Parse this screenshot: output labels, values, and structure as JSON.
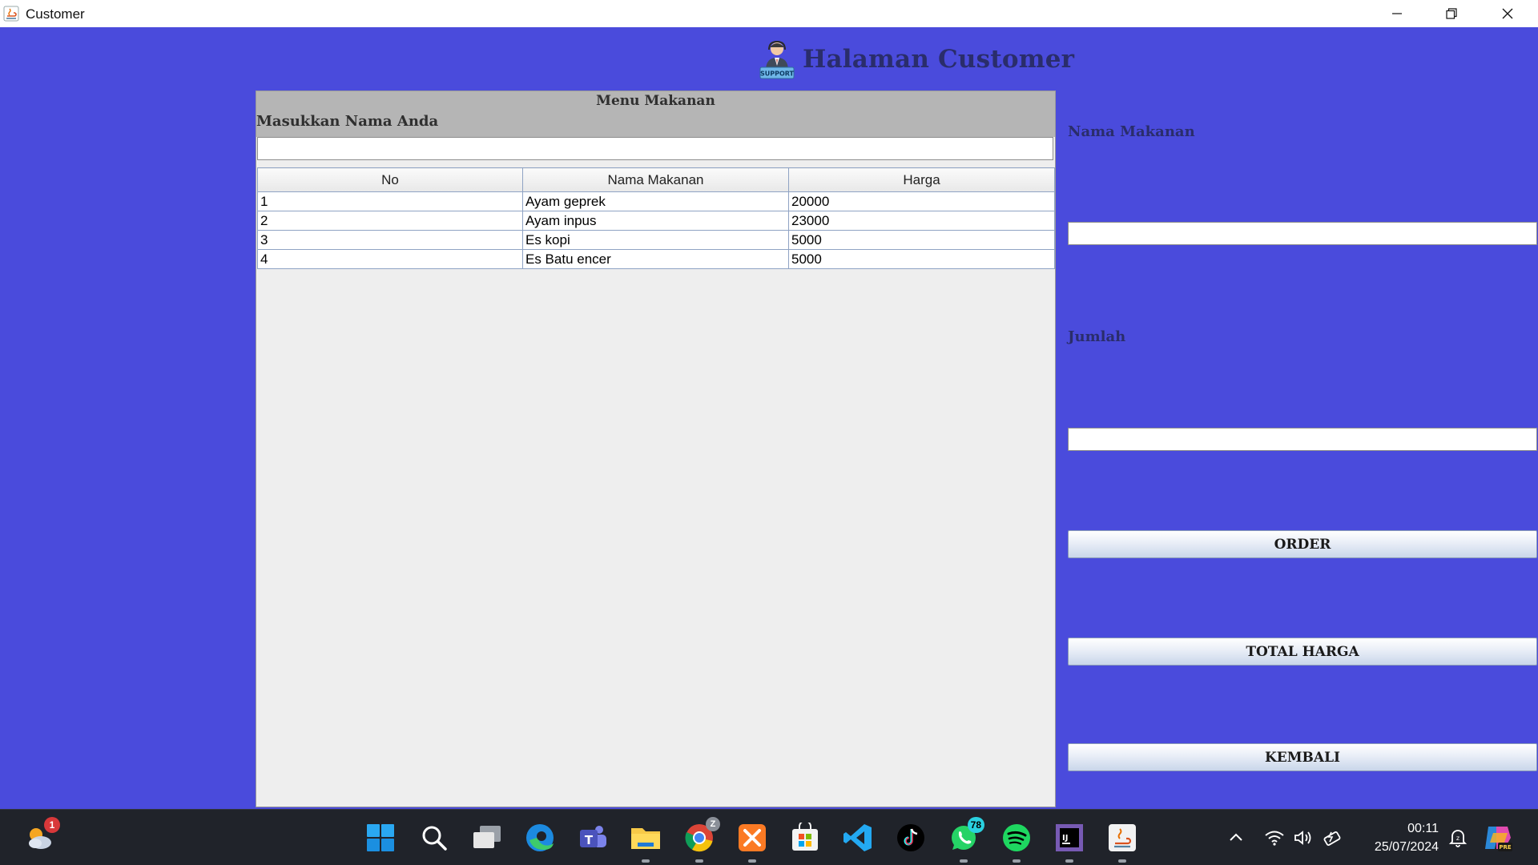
{
  "window": {
    "title": "Customer"
  },
  "header": {
    "title": "Halaman Customer",
    "logo_text": "SUPPORT"
  },
  "panel": {
    "menu_title": "Menu Makanan",
    "name_label": "Masukkan Nama Anda",
    "name_value": ""
  },
  "table": {
    "headers": [
      "No",
      "Nama Makanan",
      "Harga"
    ],
    "rows": [
      [
        "1",
        "Ayam geprek",
        "20000"
      ],
      [
        "2",
        "Ayam inpus",
        "23000"
      ],
      [
        "3",
        "Es kopi",
        "5000"
      ],
      [
        "4",
        "Es Batu encer",
        "5000"
      ]
    ]
  },
  "form": {
    "food_label": "Nama Makanan",
    "food_value": "",
    "qty_label": "Jumlah",
    "qty_value": ""
  },
  "buttons": {
    "order": "ORDER",
    "total": "TOTAL HARGA",
    "back": "KEMBALI"
  },
  "taskbar": {
    "weather_badge": "1",
    "chrome_badge": "Z",
    "whatsapp_badge": "78",
    "time": "00:11",
    "date": "25/07/2024",
    "copilot_tag": "PRE"
  },
  "colors": {
    "background": "#4a4bdc",
    "panel": "#eeeeee",
    "panel_header": "#b5b5b5",
    "title_text": "#2a2d6b"
  }
}
